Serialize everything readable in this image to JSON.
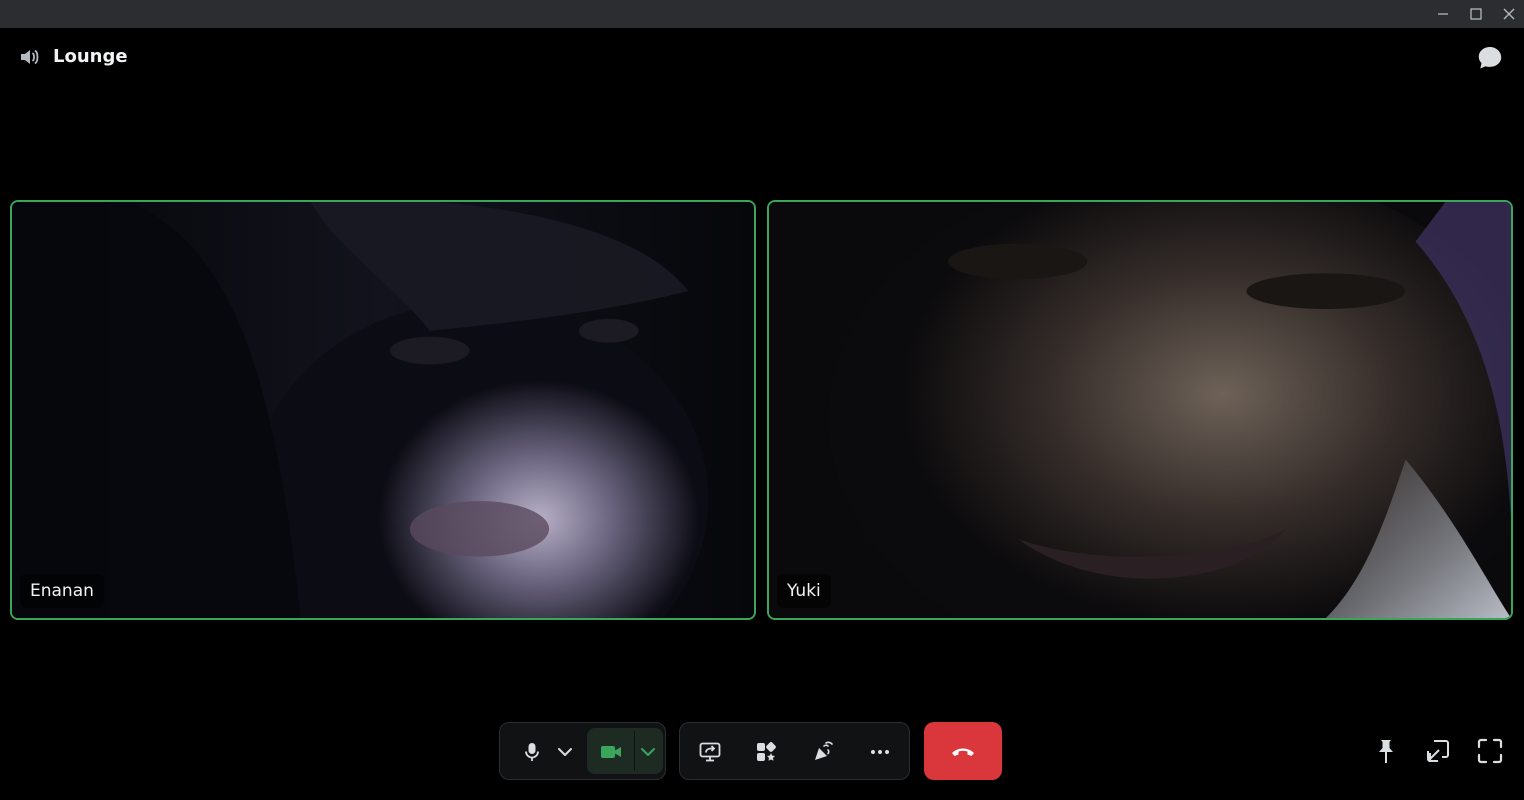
{
  "window": {
    "controls": [
      "minimize-icon",
      "maximize-icon",
      "close-icon"
    ]
  },
  "header": {
    "channel_name": "Lounge",
    "channel_icon": "speaker-icon",
    "chat_icon": "chat-bubble-icon"
  },
  "participants": [
    {
      "name": "Enanan",
      "speaking_border_color": "#3ba55c"
    },
    {
      "name": "Yuki",
      "speaking_border_color": "#3ba55c"
    }
  ],
  "controls": {
    "mic_icon": "microphone-icon",
    "camera_icon": "video-camera-icon",
    "camera_active_color": "#3ba55c",
    "share_icon": "screen-share-icon",
    "activities_icon": "activities-icon",
    "soundboard_icon": "soundboard-icon",
    "more_icon": "more-icon",
    "hangup_icon": "hang-up-icon",
    "hangup_color": "#da373c",
    "pin_icon": "pin-icon",
    "popout_icon": "pop-out-icon",
    "fullscreen_icon": "fullscreen-icon"
  }
}
